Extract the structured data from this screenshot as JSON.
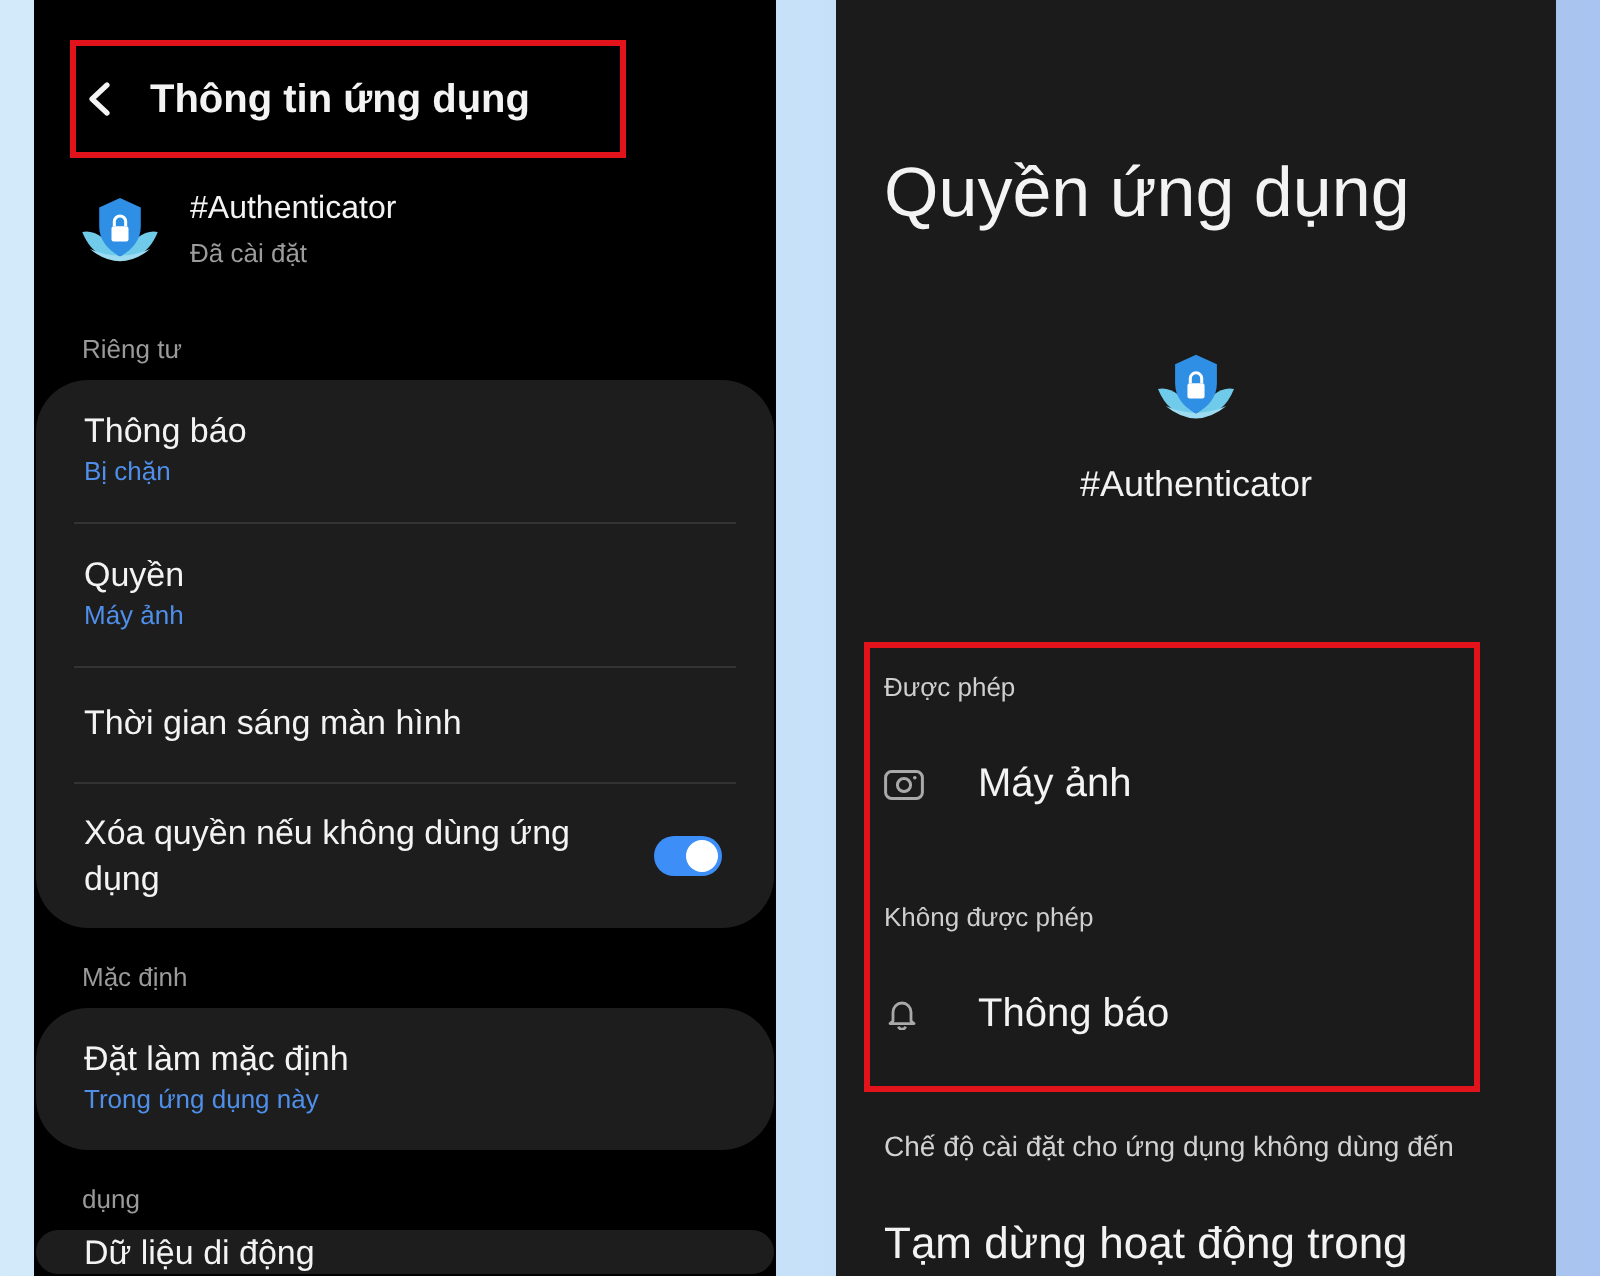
{
  "app_info": {
    "header": {
      "title": "Thông tin ứng dụng",
      "highlighted": true
    },
    "app": {
      "name": "#Authenticator",
      "status": "Đã cài đặt"
    },
    "sections": [
      {
        "label": "Riêng tư",
        "items": [
          {
            "kind": "link",
            "title": "Thông báo",
            "value": "Bị chặn"
          },
          {
            "kind": "link",
            "title": "Quyền",
            "value": "Máy ảnh"
          },
          {
            "kind": "link",
            "title": "Thời gian sáng màn hình"
          },
          {
            "kind": "toggle",
            "title": "Xóa quyền nếu không dùng ứng dụng",
            "on": true
          }
        ]
      },
      {
        "label": "Mặc định",
        "items": [
          {
            "kind": "link",
            "title": "Đặt làm mặc định",
            "value": "Trong ứng dụng này"
          }
        ]
      },
      {
        "label": "dụng",
        "items": [
          {
            "kind": "link",
            "title": "Dữ liệu di động"
          }
        ]
      }
    ]
  },
  "app_permissions": {
    "title": "Quyền ứng dụng",
    "app": {
      "name": "#Authenticator"
    },
    "permission_groups": {
      "highlighted": true,
      "groups": [
        {
          "label": "Được phép",
          "items": [
            {
              "kind": "camera",
              "name": "Máy ảnh"
            }
          ]
        },
        {
          "label": "Không được phép",
          "items": [
            {
              "kind": "notifications",
              "name": "Thông báo"
            }
          ]
        }
      ]
    },
    "unused_app_settings": {
      "label": "Chế độ cài đặt cho ứng dụng không dùng đến",
      "items": [
        {
          "title": "Tạm dừng hoạt động trong"
        }
      ]
    }
  }
}
